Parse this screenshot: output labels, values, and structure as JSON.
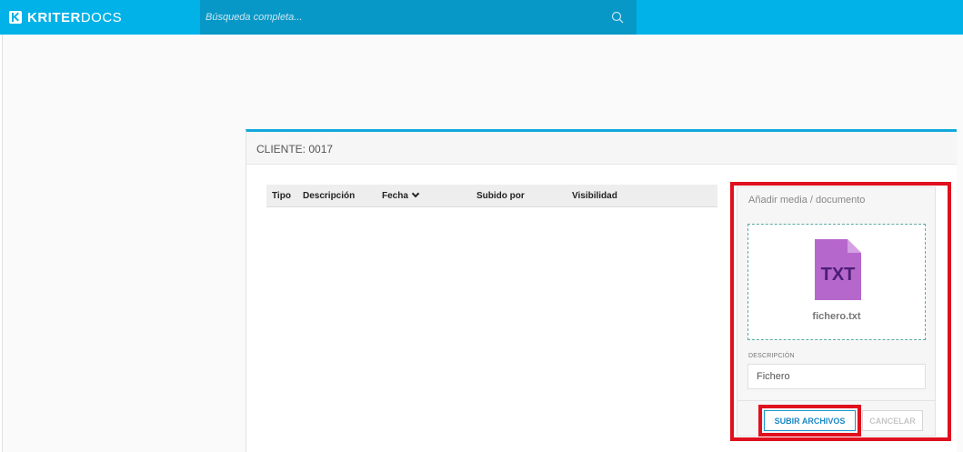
{
  "app": {
    "brand_bold": "KRITER",
    "brand_light": "DOCS"
  },
  "search": {
    "placeholder": "Búsqueda completa..."
  },
  "panel": {
    "title": "CLIENTE: 0017"
  },
  "table": {
    "columns": [
      "Tipo",
      "Descripción",
      "Fecha",
      "Subido por",
      "Visibilidad"
    ],
    "sort_column": "Fecha",
    "rows": []
  },
  "upload": {
    "title": "Añadir media / documento",
    "file": {
      "type_label": "TXT",
      "name": "fichero.txt"
    },
    "description_label": "DESCRIPCIÓN",
    "description_value": "Fichero",
    "upload_button": "SUBIR ARCHIVOS",
    "cancel_button": "CANCELAR"
  },
  "colors": {
    "topbar": "#00b2e8",
    "search_bg": "#0898c7",
    "accent": "#11a9dd",
    "file_icon": "#b667cc",
    "file_icon_text": "#4a1e73",
    "highlight": "#e0101e"
  },
  "icons": [
    "logo-icon",
    "search-icon",
    "chevron-down-icon",
    "txt-file-icon"
  ]
}
